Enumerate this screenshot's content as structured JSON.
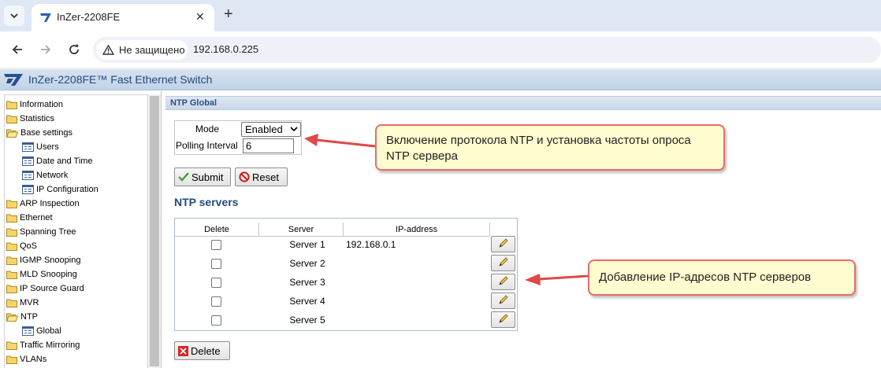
{
  "browser": {
    "tab_title": "InZer-2208FE",
    "security_label": "Не защищено",
    "url": "192.168.0.225"
  },
  "app": {
    "title": "InZer-2208FE™ Fast Ethernet Switch"
  },
  "sidebar": {
    "items": [
      {
        "label": "Information",
        "type": "folder"
      },
      {
        "label": "Statistics",
        "type": "folder"
      },
      {
        "label": "Base settings",
        "type": "folder-open"
      },
      {
        "label": "Users",
        "type": "page"
      },
      {
        "label": "Date and Time",
        "type": "page"
      },
      {
        "label": "Network",
        "type": "page"
      },
      {
        "label": "IP Configuration",
        "type": "page"
      },
      {
        "label": "ARP Inspection",
        "type": "folder"
      },
      {
        "label": "Ethernet",
        "type": "folder"
      },
      {
        "label": "Spanning Tree",
        "type": "folder"
      },
      {
        "label": "QoS",
        "type": "folder"
      },
      {
        "label": "IGMP Snooping",
        "type": "folder"
      },
      {
        "label": "MLD Snooping",
        "type": "folder"
      },
      {
        "label": "IP Source Guard",
        "type": "folder"
      },
      {
        "label": "MVR",
        "type": "folder"
      },
      {
        "label": "NTP",
        "type": "folder-open"
      },
      {
        "label": "Global",
        "type": "page"
      },
      {
        "label": "Traffic Mirroring",
        "type": "folder"
      },
      {
        "label": "VLANs",
        "type": "folder"
      }
    ]
  },
  "main": {
    "section_title": "NTP Global",
    "mode_label": "Mode",
    "mode_value": "Enabled",
    "polling_label": "Polling Interval",
    "polling_value": "6",
    "submit_label": "Submit",
    "reset_label": "Reset",
    "servers_heading": "NTP servers",
    "table_headers": [
      "Delete",
      "Server",
      "IP-address"
    ],
    "servers": [
      {
        "name": "Server 1",
        "ip": "192.168.0.1"
      },
      {
        "name": "Server 2",
        "ip": ""
      },
      {
        "name": "Server 3",
        "ip": ""
      },
      {
        "name": "Server 4",
        "ip": ""
      },
      {
        "name": "Server 5",
        "ip": ""
      }
    ],
    "delete_label": "Delete"
  },
  "callouts": {
    "ntp_enable": "Включение протокола NTP и установка частоты опроса NTP сервера",
    "ntp_servers": "Добавление IP-адресов NTP серверов"
  },
  "colors": {
    "callout_fill": "#fffccf",
    "callout_border": "#e96c6c",
    "heading_blue": "#244a7e"
  }
}
